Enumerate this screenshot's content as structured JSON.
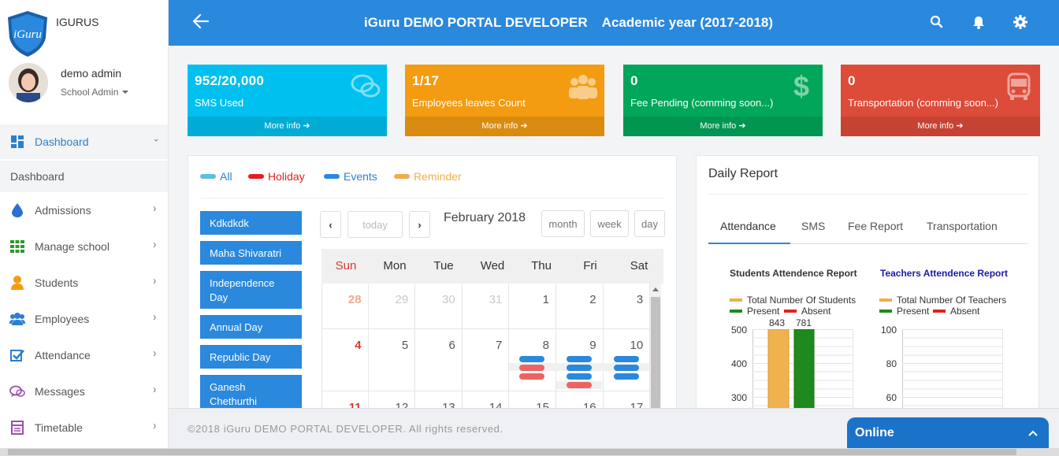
{
  "brand": {
    "name": "IGURUS"
  },
  "user": {
    "name": "demo admin",
    "role": "School Admin"
  },
  "sidebar": {
    "items": [
      {
        "label": "Dashboard",
        "icon": "dashboard-icon"
      },
      {
        "label": "Admissions",
        "icon": "drop-icon"
      },
      {
        "label": "Manage school",
        "icon": "grid-icon"
      },
      {
        "label": "Students",
        "icon": "user-icon"
      },
      {
        "label": "Employees",
        "icon": "users-icon"
      },
      {
        "label": "Attendance",
        "icon": "checkbox-icon"
      },
      {
        "label": "Messages",
        "icon": "chat-icon"
      },
      {
        "label": "Timetable",
        "icon": "table-icon"
      }
    ],
    "sub_item": "Dashboard"
  },
  "header": {
    "title": "iGuru DEMO PORTAL DEVELOPER",
    "academic_year": "Academic year (2017-2018)"
  },
  "cards": [
    {
      "value": "952/20,000",
      "label": "SMS Used",
      "more": "More info",
      "color": "#00c0ef",
      "icon": "chat-bubbles-icon"
    },
    {
      "value": "1/17",
      "label": "Employees leaves Count",
      "more": "More info",
      "color": "#f39c12",
      "icon": "group-icon"
    },
    {
      "value": "0",
      "label": "Fee Pending (comming soon...)",
      "more": "More info",
      "color": "#00a65a",
      "icon": "dollar-icon"
    },
    {
      "value": "0",
      "label": "Transportation (comming soon...)",
      "more": "More info",
      "color": "#dd4b39",
      "icon": "bus-icon"
    }
  ],
  "calendar": {
    "legend": [
      {
        "label": "All",
        "color": "#5bc0de"
      },
      {
        "label": "Holiday",
        "color": "#e02020"
      },
      {
        "label": "Events",
        "color": "#2a88dd"
      },
      {
        "label": "Reminder",
        "color": "#f0ad4e"
      }
    ],
    "events": [
      "Kdkdkdk",
      "Maha Shivaratri",
      "Independence Day",
      "Annual Day",
      "Republic Day",
      "Ganesh Chethurthi"
    ],
    "today_label": "today",
    "month_title": "February 2018",
    "views": [
      "month",
      "week",
      "day"
    ],
    "weekdays": [
      "Sun",
      "Mon",
      "Tue",
      "Wed",
      "Thu",
      "Fri",
      "Sat"
    ],
    "weeks": [
      [
        "28",
        "29",
        "30",
        "31",
        "1",
        "2",
        "3"
      ],
      [
        "4",
        "5",
        "6",
        "7",
        "8",
        "9",
        "10"
      ],
      [
        "11",
        "12",
        "13",
        "14",
        "15",
        "16",
        "17"
      ]
    ]
  },
  "daily_report": {
    "title": "Daily Report",
    "tabs": [
      "Attendance",
      "SMS",
      "Fee Report",
      "Transportation"
    ],
    "students": {
      "title": "Students Attendence Report",
      "legend": [
        "Total Number Of Students",
        "Present",
        "Absent"
      ],
      "y_ticks": [
        "500",
        "400",
        "300"
      ],
      "bar_labels": [
        "843",
        "781"
      ]
    },
    "teachers": {
      "title": "Teachers Attendence Report",
      "legend": [
        "Total Number Of Teachers",
        "Present",
        "Absent"
      ],
      "y_ticks": [
        "100",
        "80",
        "60"
      ]
    }
  },
  "footer": {
    "text": "©2018 iGuru DEMO PORTAL DEVELOPER. All rights reserved."
  },
  "online": {
    "label": "Online"
  }
}
